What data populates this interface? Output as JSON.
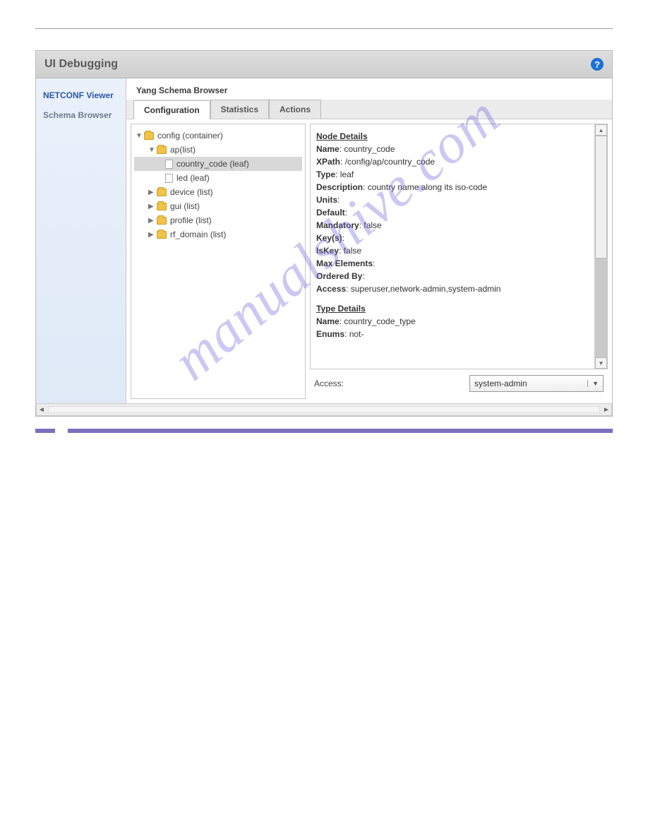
{
  "header": {
    "title": "UI Debugging"
  },
  "sidebar": {
    "items": [
      {
        "label": "NETCONF Viewer",
        "active": true
      },
      {
        "label": "Schema Browser",
        "active": false
      }
    ]
  },
  "main": {
    "section_title": "Yang Schema Browser",
    "tabs": [
      {
        "label": "Configuration",
        "active": true
      },
      {
        "label": "Statistics",
        "active": false
      },
      {
        "label": "Actions",
        "active": false
      }
    ]
  },
  "tree": [
    {
      "label": "config (container)",
      "level": 0,
      "expanded": true,
      "icon": "folder"
    },
    {
      "label": "ap(list)",
      "level": 1,
      "expanded": true,
      "icon": "folder"
    },
    {
      "label": "country_code (leaf)",
      "level": 2,
      "selected": true,
      "icon": "leaf"
    },
    {
      "label": "led (leaf)",
      "level": 2,
      "icon": "leaf"
    },
    {
      "label": "device (list)",
      "level": 1,
      "expanded": false,
      "icon": "folder"
    },
    {
      "label": "gui (list)",
      "level": 1,
      "expanded": false,
      "icon": "folder"
    },
    {
      "label": "profile (list)",
      "level": 1,
      "expanded": false,
      "icon": "folder"
    },
    {
      "label": "rf_domain (list)",
      "level": 1,
      "expanded": false,
      "icon": "folder"
    }
  ],
  "details": {
    "node_heading": "Node Details",
    "type_heading": "Type Details",
    "labels": {
      "name": "Name",
      "xpath": "XPath",
      "type": "Type",
      "description": "Description",
      "units": "Units",
      "default": "Default",
      "mandatory": "Mandatory",
      "keys": "Key(s)",
      "iskey": "IsKey",
      "max_elements": "Max Elements",
      "ordered_by": "Ordered By",
      "access": "Access",
      "enums": "Enums"
    },
    "values": {
      "name": "country_code",
      "xpath": "/config/ap/country_code",
      "type": "leaf",
      "description": "country name along its iso-code",
      "units": "",
      "default": "",
      "mandatory": "false",
      "keys": "",
      "iskey": "false",
      "max_elements": "",
      "ordered_by": "",
      "access": "superuser,network-admin,system-admin"
    },
    "type_values": {
      "name": "country_code_type",
      "enums": "not-"
    }
  },
  "access_filter": {
    "label": "Access:",
    "value": "system-admin"
  },
  "watermark": "manualshive.com"
}
